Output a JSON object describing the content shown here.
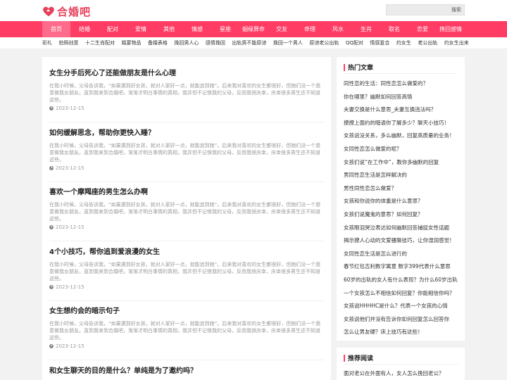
{
  "header": {
    "logo_text": "合婚吧",
    "search_placeholder": "",
    "search_button": "搜索"
  },
  "colors": {
    "accent": "#ff3c64",
    "logo": "#e8405a"
  },
  "nav": {
    "items": [
      "首页",
      "结婚",
      "配对",
      "爱情",
      "其他",
      "情感",
      "星座",
      "姻缘算命",
      "交友",
      "命理",
      "风水",
      "生肖",
      "取名",
      "恋爱",
      "挽回感情"
    ],
    "active_index": 0
  },
  "subnav": {
    "items": [
      "彩礼",
      "拍照创意",
      "十二生肖配对",
      "婚宴物品",
      "备婚表格",
      "挽回男人心",
      "感情挽回",
      "出轨男不能原谅",
      "挽回一个男人",
      "原谅老公出轨",
      "QQ配对",
      "情感复合",
      "约女生",
      "老公出轨",
      "约女生出来"
    ]
  },
  "articles": [
    {
      "title": "女生分手后死心了还能做朋友是什么心理",
      "excerpt": "在我小时候，父母告诉我，“如果遇到好女孩，就对人家好一点，就能追到她”。后来我对喜欢的女生都很好，但她们没一个愿意做我女朋友。直到我来到合婚吧，渐渐才明白事情的真相，我并但不记恨我的父母，反而我很庆幸，庆幸很多男生还不知道这些。",
      "date": "2023-12-15"
    },
    {
      "title": "如何缓解思念，帮助你更快入睡？",
      "excerpt": "在我小时候，父母告诉我，“如果遇到好女孩，就对人家好一点，就能追到她”。后来我对喜欢的女生都很好，但她们没一个愿意做我女朋友。直到我来到合婚吧，渐渐才明白事情的真相，我并但不记恨我的父母，反而我很庆幸，庆幸很多男生还不知道这些。",
      "date": "2023-12-15"
    },
    {
      "title": "喜欢一个摩羯座的男生怎么办啊",
      "excerpt": "在我小时候，父母告诉我，“如果遇到好女孩，就对人家好一点，就能追到她”。后来我对喜欢的女生都很好，但她们没一个愿意做我女朋友。直到我来到合婚吧，渐渐才明白事情的真相，我并但不记恨我的父母，反而我很庆幸，庆幸很多男生还不知道这些。",
      "date": "2023-12-15"
    },
    {
      "title": "4个小技巧，帮你追到爱浪漫的女生",
      "excerpt": "在我小时候，父母告诉我，“如果遇到好女孩，就对人家好一点，就能追到她”。后来我对喜欢的女生都很好，但她们没一个愿意做我女朋友。直到我来到合婚吧，渐渐才明白事情的真相，我并但不记恨我的父母，反而我很庆幸，庆幸很多男生还不知道这些。",
      "date": "2023-12-15"
    },
    {
      "title": "女生想约会的暗示句子",
      "excerpt": "在我小时候，父母告诉我，“如果遇到好女孩，就对人家好一点，就能追到她”。后来我对喜欢的女生都很好，但她们没一个愿意做我女朋友。直到我来到合婚吧，渐渐才明白事情的真相，我并但不记恨我的父母，反而我很庆幸，庆幸很多男生还不知道这些。",
      "date": "2023-12-15"
    },
    {
      "title": "和女生聊天的目的是什么？单纯是为了邀约吗？",
      "excerpt": "",
      "date": ""
    }
  ],
  "sidebar": {
    "hot_title": "热门文章",
    "hot_items": [
      "同性恋的生活：同性恋怎么做爱的？",
      "你在哪里？幽默如何回答高情",
      "夫妻交换是什么意思_夫妻互换违法吗？",
      "撩撩上面约的暗语你了解多少？聊天小技巧！",
      "女孩说没关系，多么幽默，回复高质量的业务！",
      "女同性恋怎么做爱的呢？",
      "女孩们说“在工作中”，教你多幽默的回复",
      "男同性恋生活是怎样解决的",
      "男性同性恋怎么做爱？",
      "女孩和你说你的体重是什么意思？",
      "女孩们说魔鬼的意思？如何回复？",
      "女孩眼泪哭泣表达如何幽默回答捕捉女性话题",
      "揭示撩人心动的文爱骚聊技巧，让你湿润感觉！",
      "女同性恋生活是怎么进行的",
      "春节红包吉利数字寓意 数字399代表什么意思",
      "60岁的出轨的女人有什么表现？为什么60岁出轨",
      "一个女孩怎么不相信如何回复？你能相信你吗？",
      "女孩说HHHHC是什么？代表一个女孩的心情",
      "女孩说他们并没有告诉你如何回复怎么回答你",
      "怎么让男友硬？床上技巧有这些！"
    ],
    "rec_title": "推荐阅读",
    "rec_items": [
      "面对老公在外面有人，女人怎么挽回老公？"
    ]
  }
}
